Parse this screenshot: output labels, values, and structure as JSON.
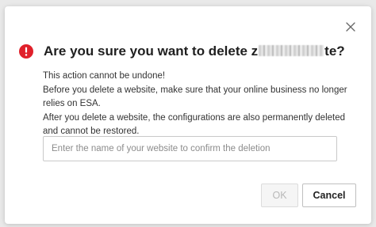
{
  "dialog": {
    "title_prefix": "Are you sure you want to delete z",
    "title_suffix": "te?",
    "lines": [
      "This action cannot be undone!",
      "Before you delete a website, make sure that your online business no longer relies on ESA.",
      "After you delete a website, the configurations are also permanently deleted and cannot be restored."
    ],
    "input": {
      "value": "",
      "placeholder": "Enter the name of your website to confirm the deletion"
    },
    "ok_label": "OK",
    "cancel_label": "Cancel",
    "ok_disabled": true
  },
  "icons": {
    "close": "close-icon",
    "warning": "exclamation-circle-icon"
  },
  "colors": {
    "warning": "#e0202a",
    "title": "#1f1f1f",
    "disabled_text": "#b8b8b8"
  }
}
